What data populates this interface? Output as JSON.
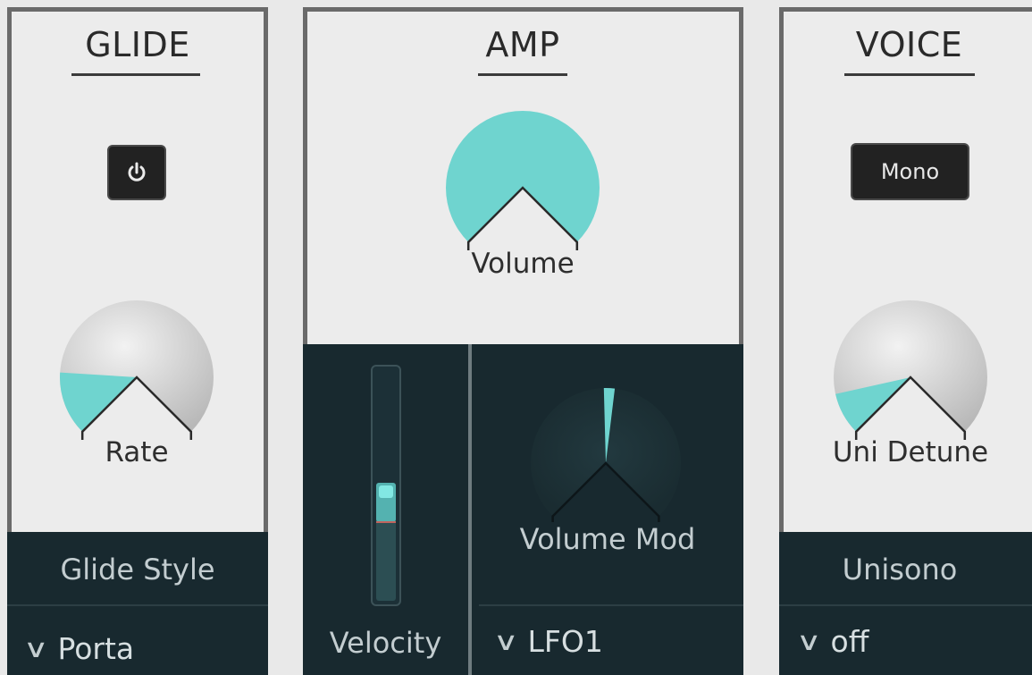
{
  "glide": {
    "title": "GLIDE",
    "knob_label": "Rate",
    "knob_value": 0.18,
    "style_label": "Glide Style",
    "style_value": "Porta",
    "power_icon": "power-icon"
  },
  "amp": {
    "title": "AMP",
    "volume_label": "Volume",
    "volume_value": 1.0,
    "velocity_label": "Velocity",
    "velocity_value": 0.42,
    "volume_mod_label": "Volume Mod",
    "volume_mod_value": 0.02,
    "mod_source": "LFO1"
  },
  "voice": {
    "title": "VOICE",
    "mode_button": "Mono",
    "knob_label": "Uni Detune",
    "knob_value": 0.12,
    "unisono_label": "Unisono",
    "unisono_value": "off"
  },
  "colors": {
    "accent": "#6fd4cf",
    "panel_dark": "#18292f",
    "panel_light": "#ececec",
    "border": "#6a6a6a"
  }
}
